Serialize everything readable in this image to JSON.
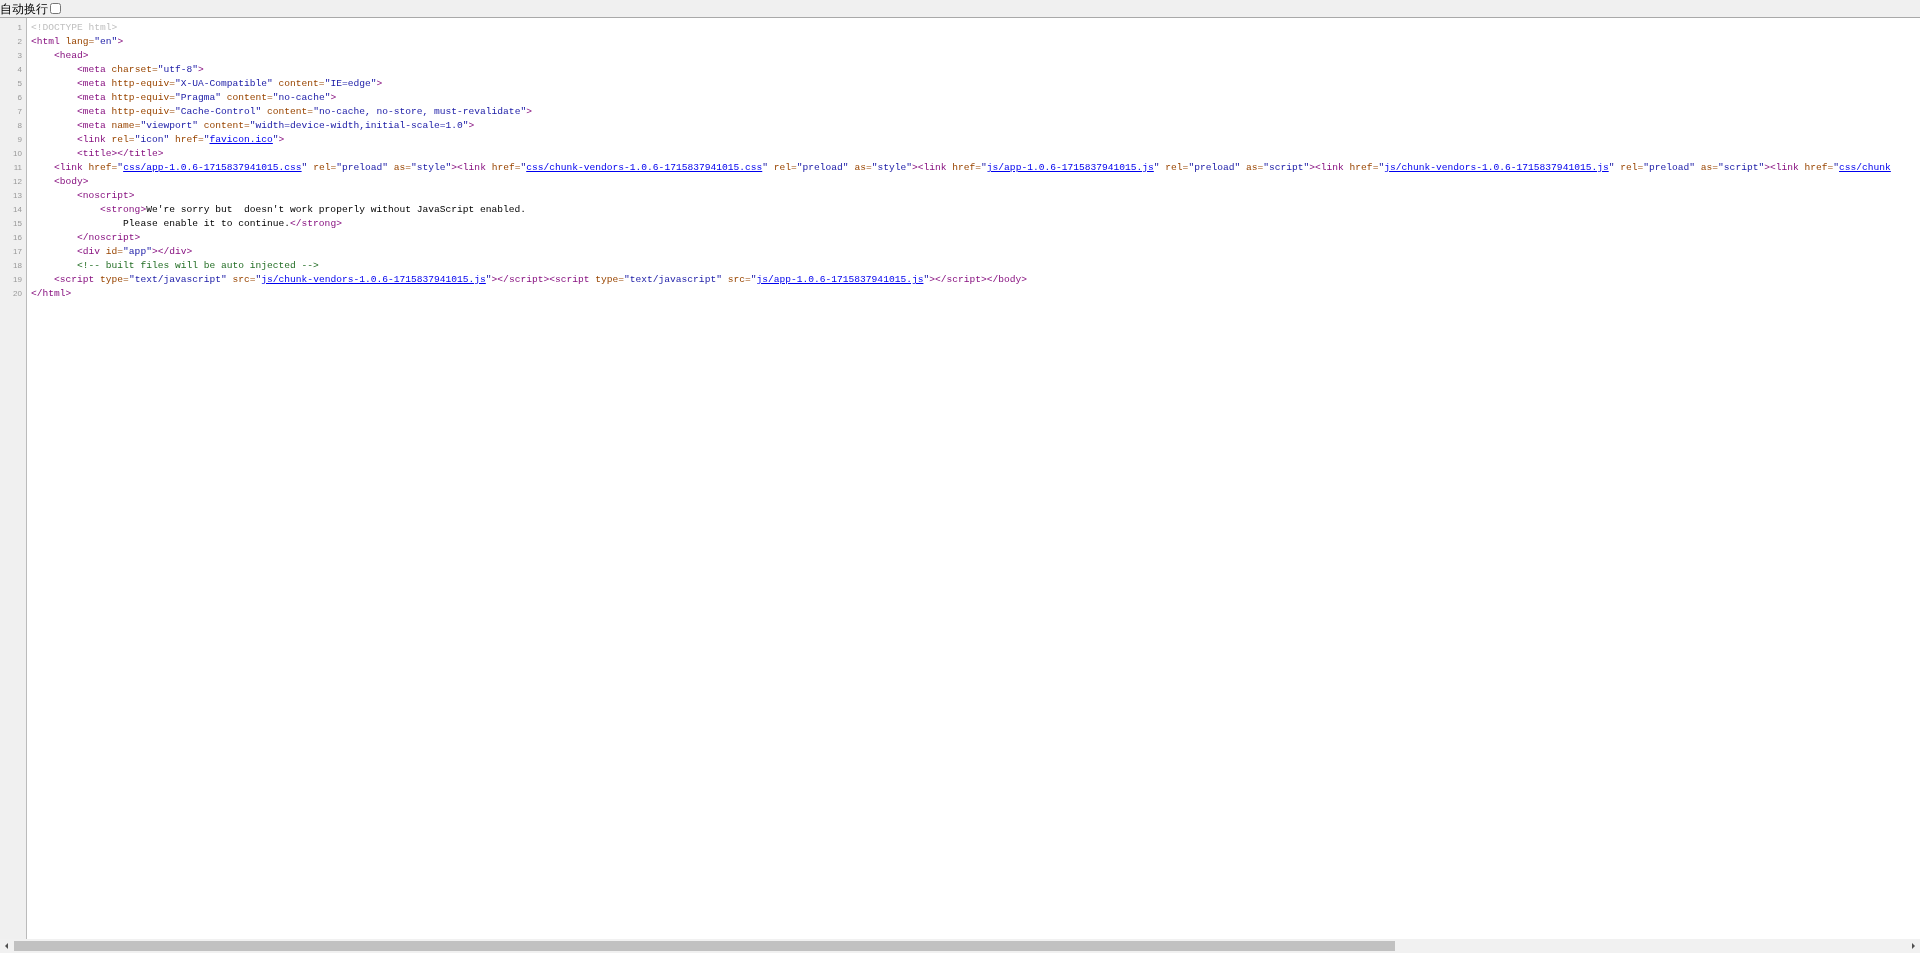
{
  "wrap_toggle": {
    "label": "自动换行",
    "checked": false
  },
  "lines": [
    {
      "number": "1",
      "tokens": [
        {
          "kind": "doctype",
          "text": "<!DOCTYPE html>"
        }
      ]
    },
    {
      "number": "2",
      "tokens": [
        {
          "kind": "tag",
          "text": "<html"
        },
        {
          "kind": "attr",
          "text": " lang="
        },
        {
          "kind": "value",
          "text": "\"en\""
        },
        {
          "kind": "tag",
          "text": ">"
        }
      ],
      "children": [
        {
          "number": "3",
          "tokens": [
            {
              "kind": "tag",
              "text": "<head>"
            }
          ],
          "children": [
            {
              "number": "4",
              "tokens": [
                {
                  "kind": "tag",
                  "text": "<meta"
                },
                {
                  "kind": "attr",
                  "text": " charset="
                },
                {
                  "kind": "value",
                  "text": "\"utf-8\""
                },
                {
                  "kind": "tag",
                  "text": ">"
                }
              ]
            },
            {
              "number": "5",
              "tokens": [
                {
                  "kind": "tag",
                  "text": "<meta"
                },
                {
                  "kind": "attr",
                  "text": " http-equiv="
                },
                {
                  "kind": "value",
                  "text": "\"X-UA-Compatible\""
                },
                {
                  "kind": "attr",
                  "text": " content="
                },
                {
                  "kind": "value",
                  "text": "\"IE=edge\""
                },
                {
                  "kind": "tag",
                  "text": ">"
                }
              ]
            },
            {
              "number": "6",
              "tokens": [
                {
                  "kind": "tag",
                  "text": "<meta"
                },
                {
                  "kind": "attr",
                  "text": " http-equiv="
                },
                {
                  "kind": "value",
                  "text": "\"Pragma\""
                },
                {
                  "kind": "attr",
                  "text": " content="
                },
                {
                  "kind": "value",
                  "text": "\"no-cache\""
                },
                {
                  "kind": "tag",
                  "text": ">"
                }
              ]
            },
            {
              "number": "7",
              "tokens": [
                {
                  "kind": "tag",
                  "text": "<meta"
                },
                {
                  "kind": "attr",
                  "text": " http-equiv="
                },
                {
                  "kind": "value",
                  "text": "\"Cache-Control\""
                },
                {
                  "kind": "attr",
                  "text": " content="
                },
                {
                  "kind": "value",
                  "text": "\"no-cache, no-store, must-revalidate\""
                },
                {
                  "kind": "tag",
                  "text": ">"
                }
              ]
            },
            {
              "number": "8",
              "tokens": [
                {
                  "kind": "tag",
                  "text": "<meta"
                },
                {
                  "kind": "attr",
                  "text": " name="
                },
                {
                  "kind": "value",
                  "text": "\"viewport\""
                },
                {
                  "kind": "attr",
                  "text": " content="
                },
                {
                  "kind": "value",
                  "text": "\"width=device-width,initial-scale=1.0\""
                },
                {
                  "kind": "tag",
                  "text": ">"
                }
              ]
            },
            {
              "number": "9",
              "tokens": [
                {
                  "kind": "tag",
                  "text": "<link"
                },
                {
                  "kind": "attr",
                  "text": " rel="
                },
                {
                  "kind": "value",
                  "text": "\"icon\""
                },
                {
                  "kind": "attr",
                  "text": " href="
                },
                {
                  "kind": "value",
                  "text": "\""
                },
                {
                  "kind": "link",
                  "text": "favicon.ico"
                },
                {
                  "kind": "value",
                  "text": "\""
                },
                {
                  "kind": "tag",
                  "text": ">"
                }
              ]
            },
            {
              "number": "10",
              "tokens": [
                {
                  "kind": "tag",
                  "text": "<title></title>"
                }
              ]
            }
          ]
        },
        {
          "number": "11",
          "tokens": [
            {
              "kind": "tag",
              "text": "<link"
            },
            {
              "kind": "attr",
              "text": " href="
            },
            {
              "kind": "value",
              "text": "\""
            },
            {
              "kind": "link",
              "text": "css/app-1.0.6-1715837941015.css"
            },
            {
              "kind": "value",
              "text": "\""
            },
            {
              "kind": "attr",
              "text": " rel="
            },
            {
              "kind": "value",
              "text": "\"preload\""
            },
            {
              "kind": "attr",
              "text": " as="
            },
            {
              "kind": "value",
              "text": "\"style\""
            },
            {
              "kind": "tag",
              "text": "><link"
            },
            {
              "kind": "attr",
              "text": " href="
            },
            {
              "kind": "value",
              "text": "\""
            },
            {
              "kind": "link",
              "text": "css/chunk-vendors-1.0.6-1715837941015.css"
            },
            {
              "kind": "value",
              "text": "\""
            },
            {
              "kind": "attr",
              "text": " rel="
            },
            {
              "kind": "value",
              "text": "\"preload\""
            },
            {
              "kind": "attr",
              "text": " as="
            },
            {
              "kind": "value",
              "text": "\"style\""
            },
            {
              "kind": "tag",
              "text": "><link"
            },
            {
              "kind": "attr",
              "text": " href="
            },
            {
              "kind": "value",
              "text": "\""
            },
            {
              "kind": "link",
              "text": "js/app-1.0.6-1715837941015.js"
            },
            {
              "kind": "value",
              "text": "\""
            },
            {
              "kind": "attr",
              "text": " rel="
            },
            {
              "kind": "value",
              "text": "\"preload\""
            },
            {
              "kind": "attr",
              "text": " as="
            },
            {
              "kind": "value",
              "text": "\"script\""
            },
            {
              "kind": "tag",
              "text": "><link"
            },
            {
              "kind": "attr",
              "text": " href="
            },
            {
              "kind": "value",
              "text": "\""
            },
            {
              "kind": "link",
              "text": "js/chunk-vendors-1.0.6-1715837941015.js"
            },
            {
              "kind": "value",
              "text": "\""
            },
            {
              "kind": "attr",
              "text": " rel="
            },
            {
              "kind": "value",
              "text": "\"preload\""
            },
            {
              "kind": "attr",
              "text": " as="
            },
            {
              "kind": "value",
              "text": "\"script\""
            },
            {
              "kind": "tag",
              "text": "><link"
            },
            {
              "kind": "attr",
              "text": " href="
            },
            {
              "kind": "value",
              "text": "\""
            },
            {
              "kind": "link",
              "text": "css/chunk"
            }
          ]
        },
        {
          "number": "12",
          "tokens": [
            {
              "kind": "tag",
              "text": "<body>"
            }
          ],
          "children": [
            {
              "number": "13",
              "tokens": [
                {
                  "kind": "tag",
                  "text": "<noscript>"
                }
              ],
              "children": [
                {
                  "number": "14",
                  "tokens": [
                    {
                      "kind": "tag",
                      "text": "<strong>"
                    },
                    {
                      "kind": "text",
                      "text": "We're sorry but  doesn't work properly without JavaScript enabled."
                    }
                  ],
                  "children": [
                    {
                      "number": "15",
                      "tokens": [
                        {
                          "kind": "text",
                          "text": "Please enable it to continue."
                        },
                        {
                          "kind": "tag",
                          "text": "</strong>"
                        }
                      ]
                    }
                  ]
                }
              ]
            },
            {
              "number": "16",
              "tokens": [
                {
                  "kind": "tag",
                  "text": "</noscript>"
                }
              ]
            },
            {
              "number": "17",
              "tokens": [
                {
                  "kind": "tag",
                  "text": "<div"
                },
                {
                  "kind": "attr",
                  "text": " id="
                },
                {
                  "kind": "value",
                  "text": "\"app\""
                },
                {
                  "kind": "tag",
                  "text": "></div>"
                }
              ]
            },
            {
              "number": "18",
              "tokens": [
                {
                  "kind": "comment",
                  "text": "<!-- built files will be auto injected -->"
                }
              ]
            }
          ]
        },
        {
          "number": "19",
          "tokens": [
            {
              "kind": "tag",
              "text": "<script"
            },
            {
              "kind": "attr",
              "text": " type="
            },
            {
              "kind": "value",
              "text": "\"text/javascript\""
            },
            {
              "kind": "attr",
              "text": " src="
            },
            {
              "kind": "value",
              "text": "\""
            },
            {
              "kind": "link",
              "text": "js/chunk-vendors-1.0.6-1715837941015.js"
            },
            {
              "kind": "value",
              "text": "\""
            },
            {
              "kind": "tag",
              "text": "></script><script"
            },
            {
              "kind": "attr",
              "text": " type="
            },
            {
              "kind": "value",
              "text": "\"text/javascript\""
            },
            {
              "kind": "attr",
              "text": " src="
            },
            {
              "kind": "value",
              "text": "\""
            },
            {
              "kind": "link",
              "text": "js/app-1.0.6-1715837941015.js"
            },
            {
              "kind": "value",
              "text": "\""
            },
            {
              "kind": "tag",
              "text": "></script></body>"
            }
          ]
        }
      ]
    },
    {
      "number": "20",
      "tokens": [
        {
          "kind": "tag",
          "text": "</html>"
        }
      ]
    }
  ]
}
